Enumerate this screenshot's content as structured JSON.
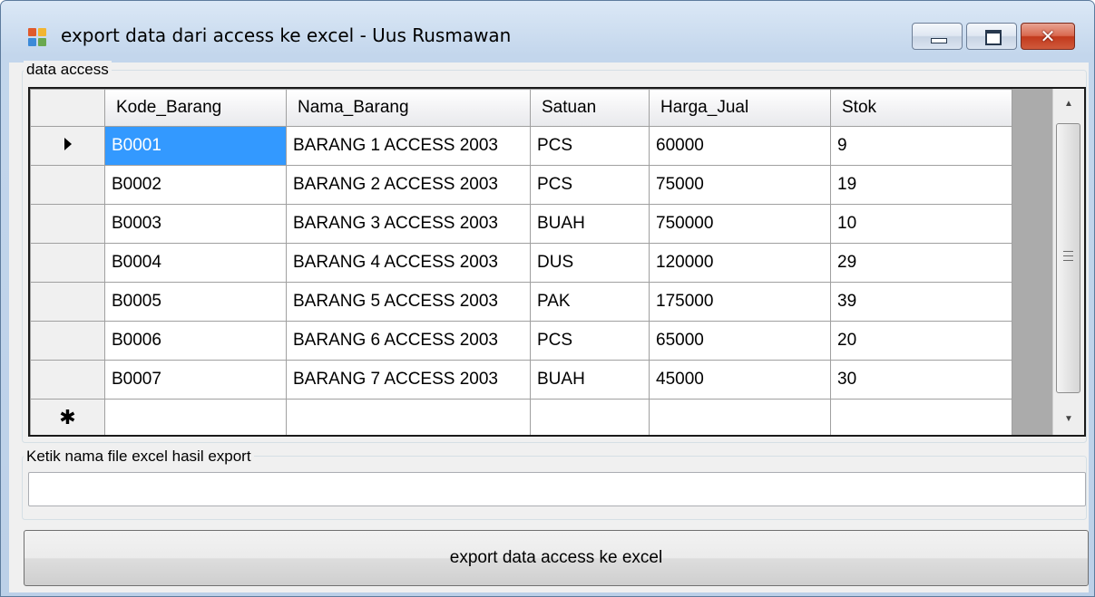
{
  "window": {
    "title": "export data dari access ke excel - Uus Rusmawan"
  },
  "groups": {
    "data_access_label": "data access",
    "filename_label": "Ketik nama file excel hasil export"
  },
  "grid": {
    "columns": [
      "Kode_Barang",
      "Nama_Barang",
      "Satuan",
      "Harga_Jual",
      "Stok"
    ],
    "rows": [
      [
        "B0001",
        "BARANG 1 ACCESS 2003",
        "PCS",
        "60000",
        "9"
      ],
      [
        "B0002",
        "BARANG 2 ACCESS 2003",
        "PCS",
        "75000",
        "19"
      ],
      [
        "B0003",
        "BARANG 3 ACCESS 2003",
        "BUAH",
        "750000",
        "10"
      ],
      [
        "B0004",
        "BARANG 4 ACCESS 2003",
        "DUS",
        "120000",
        "29"
      ],
      [
        "B0005",
        "BARANG 5 ACCESS 2003",
        "PAK",
        "175000",
        "39"
      ],
      [
        "B0006",
        "BARANG 6 ACCESS 2003",
        "PCS",
        "65000",
        "20"
      ],
      [
        "B0007",
        "BARANG 7 ACCESS 2003",
        "BUAH",
        "45000",
        "30"
      ]
    ],
    "current_row_indicator": "▶",
    "new_row_indicator": "*",
    "selected_cell": "B0001"
  },
  "filename_input": {
    "value": "",
    "placeholder": ""
  },
  "export_button": {
    "label": "export data access ke excel"
  },
  "icons": {
    "app": "app-form-icon",
    "minimize": "minimize-icon",
    "maximize": "maximize-icon",
    "close": "close-icon",
    "scroll_up": "scroll-up-arrow-icon",
    "scroll_down": "scroll-down-arrow-icon"
  },
  "colors": {
    "selection": "#3399ff",
    "close_button": "#c2391c",
    "grid_background": "#ababab"
  }
}
